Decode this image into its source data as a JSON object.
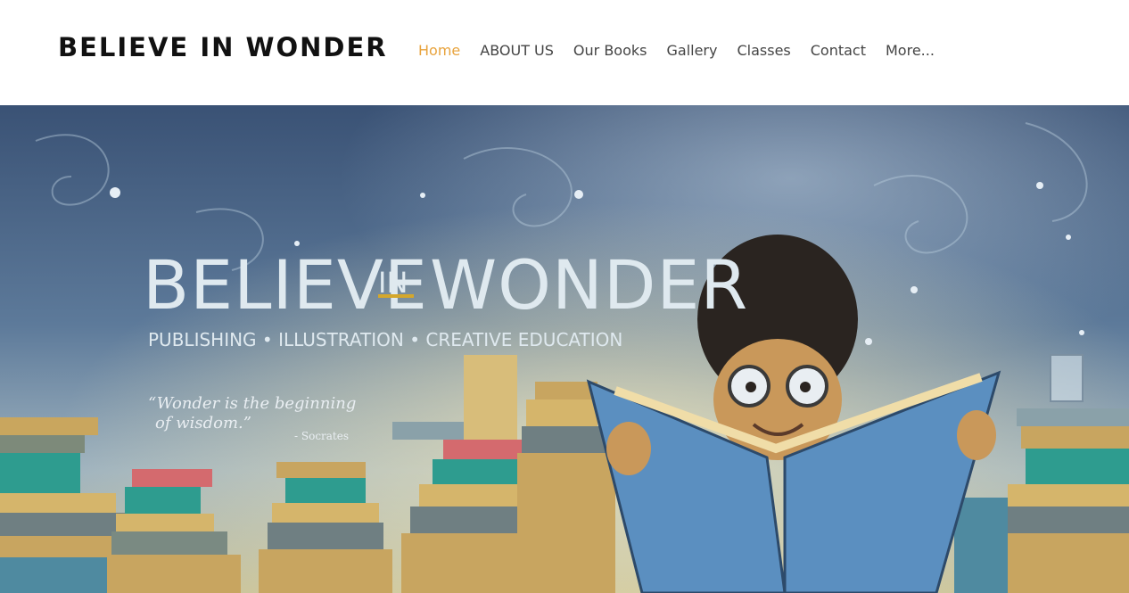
{
  "header": {
    "site_title": "BELIEVE IN WONDER",
    "nav": [
      {
        "label": "Home",
        "active": true
      },
      {
        "label": "ABOUT US",
        "active": false
      },
      {
        "label": "Our Books",
        "active": false
      },
      {
        "label": "Gallery",
        "active": false
      },
      {
        "label": "Classes",
        "active": false
      },
      {
        "label": "Contact",
        "active": false
      },
      {
        "label": "More...",
        "active": false
      }
    ]
  },
  "hero": {
    "title_left": "BELIEVE",
    "title_in": "IN",
    "title_right": "WONDER",
    "subtitle": "PUBLISHING • ILLUSTRATION • CREATIVE EDUCATION",
    "quote_line1": "“Wonder is the beginning",
    "quote_line2": "of wisdom.”",
    "quote_author": "- Socrates"
  },
  "colors": {
    "accent": "#e8a33d",
    "nav_text": "#444444",
    "title_text": "#111111",
    "sky_dark": "#31486b",
    "sky_light": "#8ea8c2",
    "glow": "#e8d6a0",
    "banner_text": "#dfe9ef",
    "underline": "#d4a72c"
  }
}
